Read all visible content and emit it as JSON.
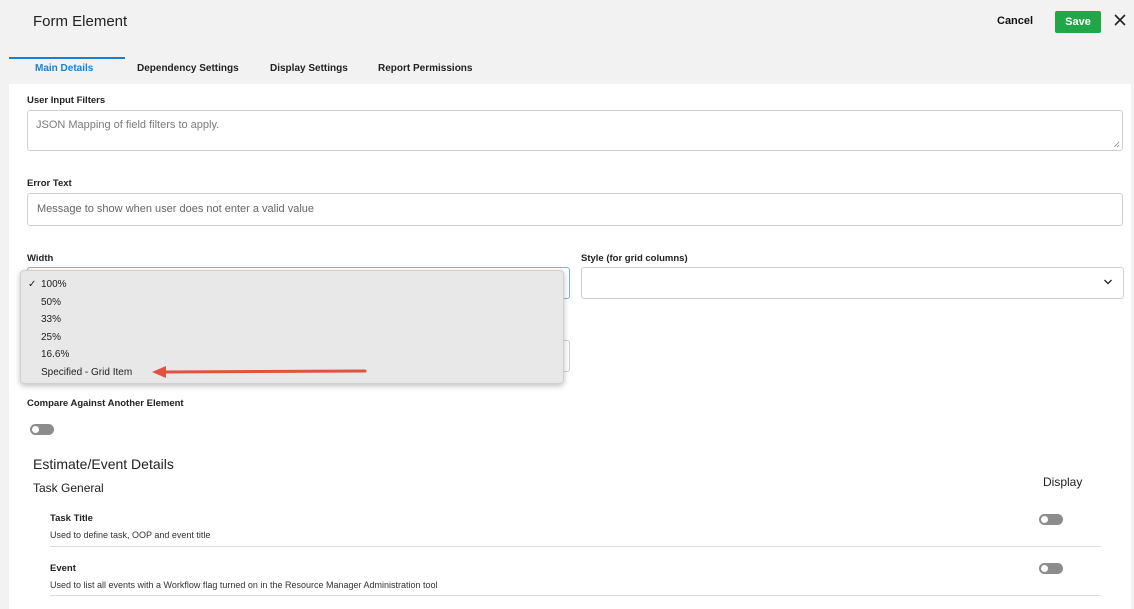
{
  "header": {
    "title": "Form Element",
    "cancel_label": "Cancel",
    "save_label": "Save"
  },
  "tabs": [
    {
      "label": "Main Details",
      "active": true
    },
    {
      "label": "Dependency Settings",
      "active": false
    },
    {
      "label": "Display Settings",
      "active": false
    },
    {
      "label": "Report Permissions",
      "active": false
    }
  ],
  "fields": {
    "user_input_filters": {
      "label": "User Input Filters",
      "placeholder": "JSON Mapping of field filters to apply."
    },
    "error_text": {
      "label": "Error Text",
      "placeholder": "Message to show when user does not enter a valid value"
    },
    "width": {
      "label": "Width",
      "selected": "100%"
    },
    "style": {
      "label": "Style (for grid columns)",
      "value": ""
    },
    "compare": {
      "label": "Compare Against Another Element",
      "enabled": false
    }
  },
  "width_dropdown": {
    "check_mark": "✓",
    "options": [
      "100%",
      "50%",
      "33%",
      "25%",
      "16.6%",
      "Specified - Grid Item"
    ]
  },
  "estimate": {
    "title": "Estimate/Event Details",
    "group": "Task General",
    "display_header": "Display",
    "rows": [
      {
        "title": "Task Title",
        "description": "Used to define task, OOP and event title",
        "display": false
      },
      {
        "title": "Event",
        "description": "Used to list all events with a Workflow flag turned on in the Resource Manager Administration tool",
        "display": false
      }
    ]
  },
  "colors": {
    "accent": "#1a7fd0",
    "save": "#22a64a",
    "annotation_arrow": "#e0533f"
  },
  "icons": {
    "close": "close-icon",
    "dropdown": "chevron-down-icon",
    "arrow": "annotation-arrow-icon"
  }
}
